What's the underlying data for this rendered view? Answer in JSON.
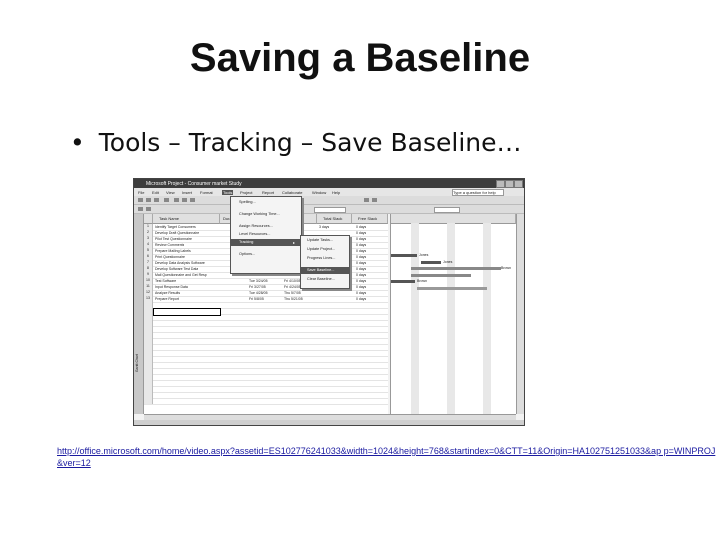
{
  "slide": {
    "title": "Saving a Baseline",
    "bullet_marker": "•",
    "bullet_text": "Tools – Tracking – Save Baseline…",
    "link": "http://office.microsoft.com/home/video.aspx?assetid=ES102776241033&width=1024&height=768&startindex=0&CTT=11&Origin=HA102751251033&ap p=WINPROJ&ver=12"
  },
  "screenshot": {
    "window_title": "Microsoft Project - Consumer market Study",
    "menus": [
      "File",
      "Edit",
      "View",
      "Insert",
      "Format",
      "Tools",
      "Project",
      "Report",
      "Collaborate",
      "Window",
      "Help"
    ],
    "search_placeholder": "Type a question for help",
    "columns": [
      "Task Name",
      "Duration",
      "Start",
      "Finish",
      "Total Slack",
      "Free Slack"
    ],
    "tasks": [
      {
        "id": "1",
        "name": "Identify Target Consumers",
        "start": "",
        "finish": "Tu 3/1/005",
        "slack": "3 days",
        "free": "0 days"
      },
      {
        "id": "2",
        "name": "Develop Draft Questionnaire",
        "start": "",
        "finish": "",
        "slack": "",
        "free": "0 days"
      },
      {
        "id": "3",
        "name": "Pilot Test Questionnaire",
        "start": "",
        "finish": "",
        "slack": "",
        "free": "0 days"
      },
      {
        "id": "4",
        "name": "Review Comments",
        "start": "",
        "finish": "",
        "slack": "",
        "free": "0 days"
      },
      {
        "id": "5",
        "name": "Prepare Mailing Labels",
        "start": "",
        "finish": "",
        "slack": "",
        "free": "0 days"
      },
      {
        "id": "6",
        "name": "Print Questionnaire",
        "start": "Fri 3/13/05",
        "slack": "",
        "finish": "",
        "free": "0 days"
      },
      {
        "id": "7",
        "name": "Develop Data Analysis Software",
        "start": "Fri 3/13/05",
        "finish": "",
        "slack": "",
        "free": "0 days"
      },
      {
        "id": "8",
        "name": "Develop Software Test Data",
        "start": "Fri 3/13/05",
        "finish": "",
        "slack": "",
        "free": "0 days"
      },
      {
        "id": "9",
        "name": "Mail Questionnaire and Get Resp",
        "start": "Fri 3/20/05",
        "finish": "Thu 3/26/05",
        "slack": "",
        "free": "0 days"
      },
      {
        "id": "10",
        "name": "Test Software",
        "start": "Tue 3/24/05",
        "finish": "Fri 4/10/05",
        "slack": "",
        "free": "0 days"
      },
      {
        "id": "11",
        "name": "Input Response Data",
        "start": "Fri 3/27/05",
        "finish": "Fri 4/24/05",
        "slack": "",
        "free": "0 days"
      },
      {
        "id": "12",
        "name": "Analyze Results",
        "start": "Tue 4/28/05",
        "finish": "Thu 5/7/05",
        "slack": "",
        "free": "0 days"
      },
      {
        "id": "13",
        "name": "Prepare Report",
        "start": "Fri 5/8/05",
        "finish": "Thu 5/21/05",
        "slack": "",
        "free": "0 days"
      }
    ],
    "tools_menu": [
      "Spelling...",
      "Change Working Time...",
      "Assign Resources...",
      "Level Resources...",
      "Tracking",
      "Options..."
    ],
    "tracking_submenu": [
      "Update Tasks...",
      "Update Project...",
      "Progress Lines...",
      "Save Baseline...",
      "Clear Baseline..."
    ],
    "gantt_labels": [
      "Jones",
      "Jones",
      "Brown",
      "Brown"
    ],
    "sidebar_label": "Gantt Chart"
  }
}
